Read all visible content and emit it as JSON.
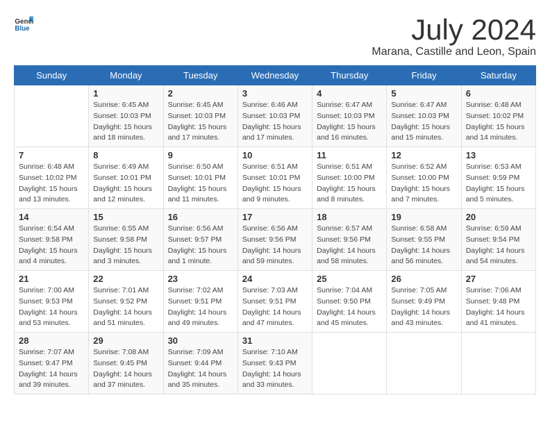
{
  "header": {
    "logo": {
      "text_general": "General",
      "text_blue": "Blue"
    },
    "title": "July 2024",
    "subtitle": "Marana, Castille and Leon, Spain"
  },
  "weekdays": [
    "Sunday",
    "Monday",
    "Tuesday",
    "Wednesday",
    "Thursday",
    "Friday",
    "Saturday"
  ],
  "weeks": [
    [
      {
        "day": "",
        "sunrise": "",
        "sunset": "",
        "daylight": ""
      },
      {
        "day": "1",
        "sunrise": "Sunrise: 6:45 AM",
        "sunset": "Sunset: 10:03 PM",
        "daylight": "Daylight: 15 hours and 18 minutes."
      },
      {
        "day": "2",
        "sunrise": "Sunrise: 6:45 AM",
        "sunset": "Sunset: 10:03 PM",
        "daylight": "Daylight: 15 hours and 17 minutes."
      },
      {
        "day": "3",
        "sunrise": "Sunrise: 6:46 AM",
        "sunset": "Sunset: 10:03 PM",
        "daylight": "Daylight: 15 hours and 17 minutes."
      },
      {
        "day": "4",
        "sunrise": "Sunrise: 6:47 AM",
        "sunset": "Sunset: 10:03 PM",
        "daylight": "Daylight: 15 hours and 16 minutes."
      },
      {
        "day": "5",
        "sunrise": "Sunrise: 6:47 AM",
        "sunset": "Sunset: 10:03 PM",
        "daylight": "Daylight: 15 hours and 15 minutes."
      },
      {
        "day": "6",
        "sunrise": "Sunrise: 6:48 AM",
        "sunset": "Sunset: 10:02 PM",
        "daylight": "Daylight: 15 hours and 14 minutes."
      }
    ],
    [
      {
        "day": "7",
        "sunrise": "Sunrise: 6:48 AM",
        "sunset": "Sunset: 10:02 PM",
        "daylight": "Daylight: 15 hours and 13 minutes."
      },
      {
        "day": "8",
        "sunrise": "Sunrise: 6:49 AM",
        "sunset": "Sunset: 10:01 PM",
        "daylight": "Daylight: 15 hours and 12 minutes."
      },
      {
        "day": "9",
        "sunrise": "Sunrise: 6:50 AM",
        "sunset": "Sunset: 10:01 PM",
        "daylight": "Daylight: 15 hours and 11 minutes."
      },
      {
        "day": "10",
        "sunrise": "Sunrise: 6:51 AM",
        "sunset": "Sunset: 10:01 PM",
        "daylight": "Daylight: 15 hours and 9 minutes."
      },
      {
        "day": "11",
        "sunrise": "Sunrise: 6:51 AM",
        "sunset": "Sunset: 10:00 PM",
        "daylight": "Daylight: 15 hours and 8 minutes."
      },
      {
        "day": "12",
        "sunrise": "Sunrise: 6:52 AM",
        "sunset": "Sunset: 10:00 PM",
        "daylight": "Daylight: 15 hours and 7 minutes."
      },
      {
        "day": "13",
        "sunrise": "Sunrise: 6:53 AM",
        "sunset": "Sunset: 9:59 PM",
        "daylight": "Daylight: 15 hours and 5 minutes."
      }
    ],
    [
      {
        "day": "14",
        "sunrise": "Sunrise: 6:54 AM",
        "sunset": "Sunset: 9:58 PM",
        "daylight": "Daylight: 15 hours and 4 minutes."
      },
      {
        "day": "15",
        "sunrise": "Sunrise: 6:55 AM",
        "sunset": "Sunset: 9:58 PM",
        "daylight": "Daylight: 15 hours and 3 minutes."
      },
      {
        "day": "16",
        "sunrise": "Sunrise: 6:56 AM",
        "sunset": "Sunset: 9:57 PM",
        "daylight": "Daylight: 15 hours and 1 minute."
      },
      {
        "day": "17",
        "sunrise": "Sunrise: 6:56 AM",
        "sunset": "Sunset: 9:56 PM",
        "daylight": "Daylight: 14 hours and 59 minutes."
      },
      {
        "day": "18",
        "sunrise": "Sunrise: 6:57 AM",
        "sunset": "Sunset: 9:56 PM",
        "daylight": "Daylight: 14 hours and 58 minutes."
      },
      {
        "day": "19",
        "sunrise": "Sunrise: 6:58 AM",
        "sunset": "Sunset: 9:55 PM",
        "daylight": "Daylight: 14 hours and 56 minutes."
      },
      {
        "day": "20",
        "sunrise": "Sunrise: 6:59 AM",
        "sunset": "Sunset: 9:54 PM",
        "daylight": "Daylight: 14 hours and 54 minutes."
      }
    ],
    [
      {
        "day": "21",
        "sunrise": "Sunrise: 7:00 AM",
        "sunset": "Sunset: 9:53 PM",
        "daylight": "Daylight: 14 hours and 53 minutes."
      },
      {
        "day": "22",
        "sunrise": "Sunrise: 7:01 AM",
        "sunset": "Sunset: 9:52 PM",
        "daylight": "Daylight: 14 hours and 51 minutes."
      },
      {
        "day": "23",
        "sunrise": "Sunrise: 7:02 AM",
        "sunset": "Sunset: 9:51 PM",
        "daylight": "Daylight: 14 hours and 49 minutes."
      },
      {
        "day": "24",
        "sunrise": "Sunrise: 7:03 AM",
        "sunset": "Sunset: 9:51 PM",
        "daylight": "Daylight: 14 hours and 47 minutes."
      },
      {
        "day": "25",
        "sunrise": "Sunrise: 7:04 AM",
        "sunset": "Sunset: 9:50 PM",
        "daylight": "Daylight: 14 hours and 45 minutes."
      },
      {
        "day": "26",
        "sunrise": "Sunrise: 7:05 AM",
        "sunset": "Sunset: 9:49 PM",
        "daylight": "Daylight: 14 hours and 43 minutes."
      },
      {
        "day": "27",
        "sunrise": "Sunrise: 7:06 AM",
        "sunset": "Sunset: 9:48 PM",
        "daylight": "Daylight: 14 hours and 41 minutes."
      }
    ],
    [
      {
        "day": "28",
        "sunrise": "Sunrise: 7:07 AM",
        "sunset": "Sunset: 9:47 PM",
        "daylight": "Daylight: 14 hours and 39 minutes."
      },
      {
        "day": "29",
        "sunrise": "Sunrise: 7:08 AM",
        "sunset": "Sunset: 9:45 PM",
        "daylight": "Daylight: 14 hours and 37 minutes."
      },
      {
        "day": "30",
        "sunrise": "Sunrise: 7:09 AM",
        "sunset": "Sunset: 9:44 PM",
        "daylight": "Daylight: 14 hours and 35 minutes."
      },
      {
        "day": "31",
        "sunrise": "Sunrise: 7:10 AM",
        "sunset": "Sunset: 9:43 PM",
        "daylight": "Daylight: 14 hours and 33 minutes."
      },
      {
        "day": "",
        "sunrise": "",
        "sunset": "",
        "daylight": ""
      },
      {
        "day": "",
        "sunrise": "",
        "sunset": "",
        "daylight": ""
      },
      {
        "day": "",
        "sunrise": "",
        "sunset": "",
        "daylight": ""
      }
    ]
  ]
}
